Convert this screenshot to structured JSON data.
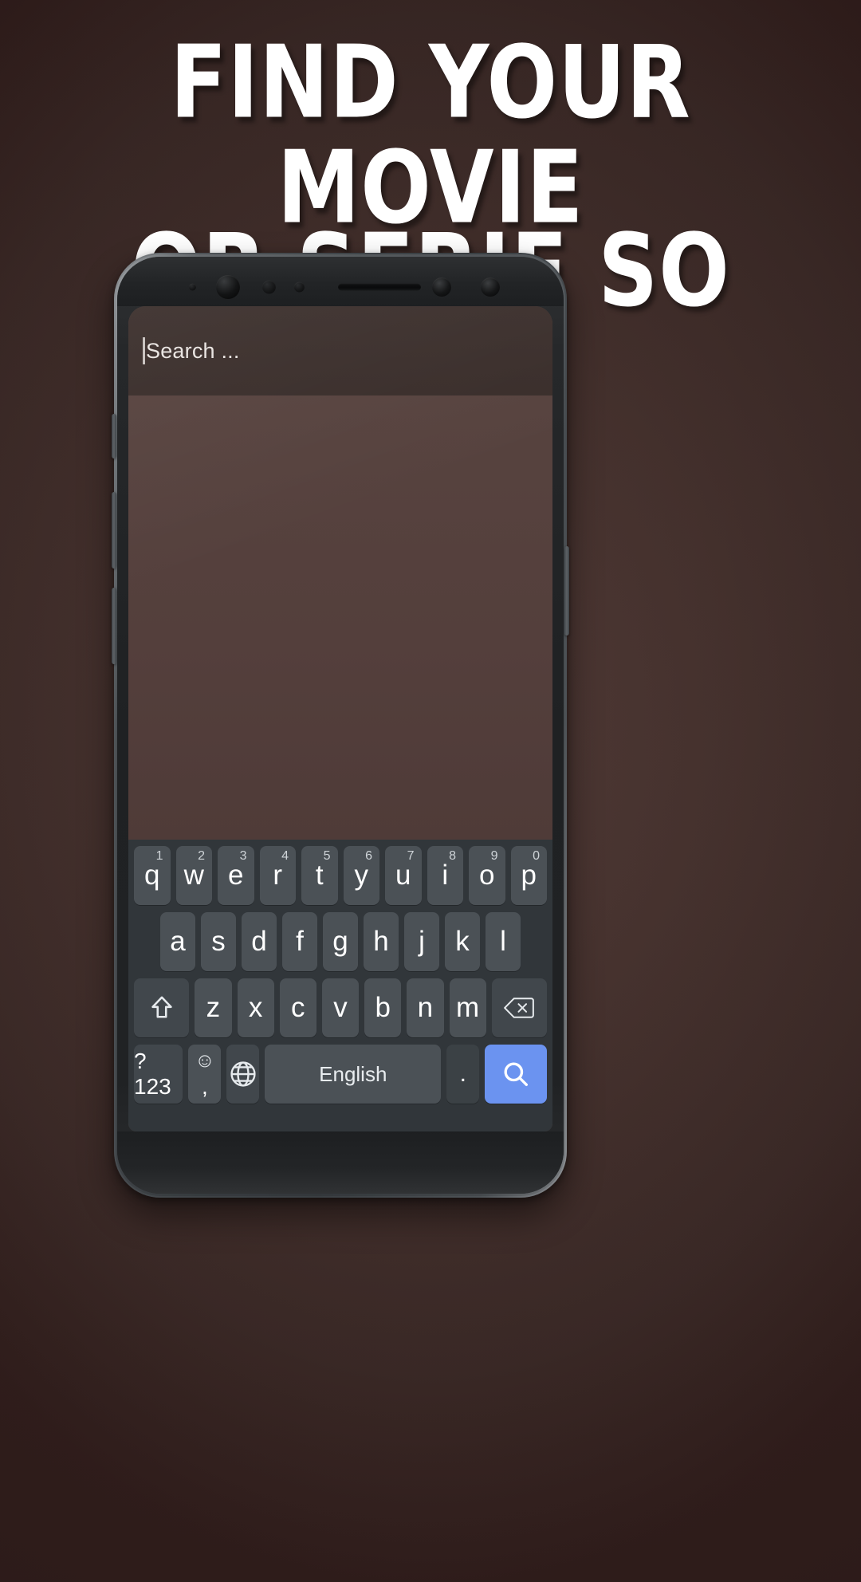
{
  "promo": {
    "headline_line1": "Find Your Movie",
    "headline_line2": "Or Serie So Fast",
    "background_color": "#46312d",
    "headline_color": "#ffffff"
  },
  "device": {
    "frame_color": "#4e5357",
    "bezel_color": "#202224",
    "sensors": [
      "proximity-sensor",
      "front-camera",
      "ir-sensor",
      "light-sensor",
      "earpiece-speaker",
      "iris-scanner",
      "led-indicator"
    ]
  },
  "app": {
    "search": {
      "placeholder": "Search ...",
      "value": "",
      "caret_visible": true,
      "bar_color": "#3a2e2b"
    },
    "content": {
      "background_color": "#55413d",
      "items": []
    }
  },
  "keyboard": {
    "background_color": "#31363a",
    "key_color": "#4b5156",
    "fn_key_color": "#41474c",
    "enter_key_color": "#6b93f0",
    "row1": [
      {
        "label": "q",
        "sup": "1"
      },
      {
        "label": "w",
        "sup": "2"
      },
      {
        "label": "e",
        "sup": "3"
      },
      {
        "label": "r",
        "sup": "4"
      },
      {
        "label": "t",
        "sup": "5"
      },
      {
        "label": "y",
        "sup": "6"
      },
      {
        "label": "u",
        "sup": "7"
      },
      {
        "label": "i",
        "sup": "8"
      },
      {
        "label": "o",
        "sup": "9"
      },
      {
        "label": "p",
        "sup": "0"
      }
    ],
    "row2": [
      {
        "label": "a"
      },
      {
        "label": "s"
      },
      {
        "label": "d"
      },
      {
        "label": "f"
      },
      {
        "label": "g"
      },
      {
        "label": "h"
      },
      {
        "label": "j"
      },
      {
        "label": "k"
      },
      {
        "label": "l"
      }
    ],
    "row3": [
      {
        "label": "z"
      },
      {
        "label": "x"
      },
      {
        "label": "c"
      },
      {
        "label": "v"
      },
      {
        "label": "b"
      },
      {
        "label": "n"
      },
      {
        "label": "m"
      }
    ],
    "shift_key": {
      "icon": "shift-arrow-icon",
      "label": ""
    },
    "backspace_key": {
      "icon": "backspace-icon",
      "label": ""
    },
    "symbols_key": {
      "label": "?123"
    },
    "emoji_key": {
      "face": "☺",
      "comma": ","
    },
    "language_key": {
      "icon": "globe-icon",
      "label": ""
    },
    "space_key": {
      "label": "English"
    },
    "period_key": {
      "label": "."
    },
    "enter_key": {
      "icon": "search-icon",
      "label": ""
    }
  }
}
